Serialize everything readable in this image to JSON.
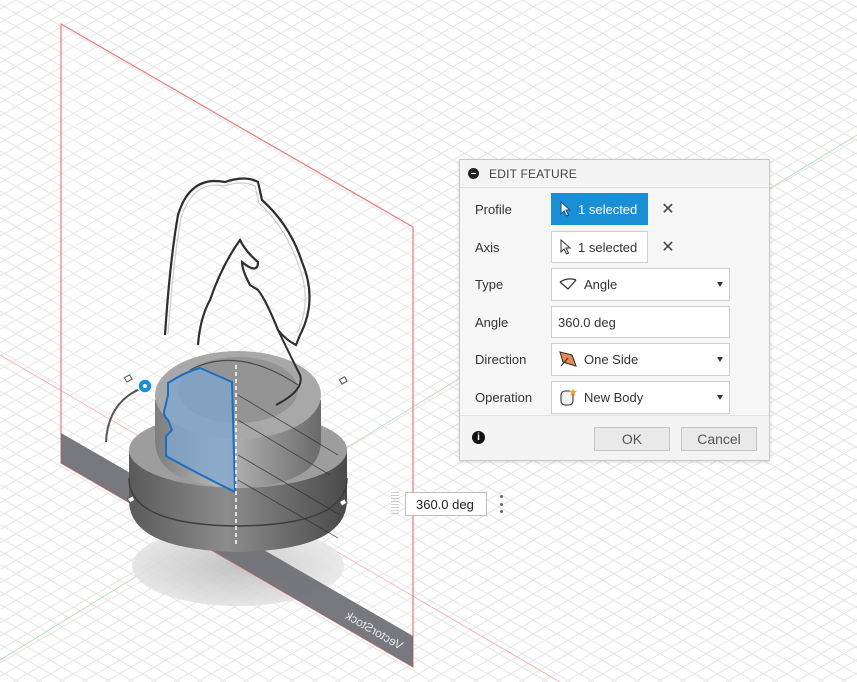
{
  "dialog": {
    "title": "EDIT FEATURE",
    "rows": {
      "profile": {
        "label": "Profile",
        "value": "1 selected"
      },
      "axis": {
        "label": "Axis",
        "value": "1 selected"
      },
      "type": {
        "label": "Type",
        "value": "Angle",
        "icon": "angle-icon"
      },
      "angle": {
        "label": "Angle",
        "value": "360.0 deg"
      },
      "direction": {
        "label": "Direction",
        "value": "One Side",
        "icon": "one-side-icon"
      },
      "operation": {
        "label": "Operation",
        "value": "New Body",
        "icon": "new-body-icon"
      }
    },
    "ok_label": "OK",
    "cancel_label": "Cancel"
  },
  "canvas_input": {
    "value": "360.0 deg"
  },
  "sketch_plane_text": "VectorStock",
  "colors": {
    "accent": "#1b8fd6",
    "plane_border": "#e87a7a",
    "plane_tab": "#6d6e73",
    "profile_fill": "#7ea6cf"
  }
}
